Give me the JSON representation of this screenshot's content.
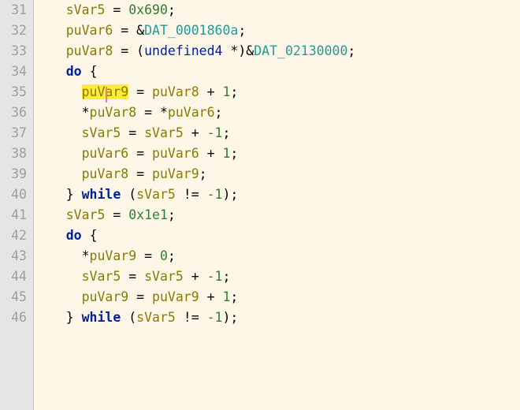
{
  "lines": [
    {
      "num": "31",
      "indent": "    ",
      "tokens": [
        {
          "t": "sVar5",
          "c": "tk-var"
        },
        {
          "t": " ",
          "c": ""
        },
        {
          "t": "=",
          "c": "tk-op"
        },
        {
          "t": " ",
          "c": ""
        },
        {
          "t": "0x690",
          "c": "tk-num"
        },
        {
          "t": ";",
          "c": "tk-punc"
        }
      ]
    },
    {
      "num": "32",
      "indent": "    ",
      "tokens": [
        {
          "t": "puVar6",
          "c": "tk-var"
        },
        {
          "t": " ",
          "c": ""
        },
        {
          "t": "=",
          "c": "tk-op"
        },
        {
          "t": " ",
          "c": ""
        },
        {
          "t": "&",
          "c": "tk-op"
        },
        {
          "t": "DAT_0001860a",
          "c": "tk-dat"
        },
        {
          "t": ";",
          "c": "tk-punc"
        }
      ]
    },
    {
      "num": "33",
      "indent": "    ",
      "tokens": [
        {
          "t": "puVar8",
          "c": "tk-var"
        },
        {
          "t": " ",
          "c": ""
        },
        {
          "t": "=",
          "c": "tk-op"
        },
        {
          "t": " ",
          "c": ""
        },
        {
          "t": "(",
          "c": "tk-punc"
        },
        {
          "t": "undefined4",
          "c": "tk-type"
        },
        {
          "t": " ",
          "c": ""
        },
        {
          "t": "*",
          "c": "tk-op"
        },
        {
          "t": ")",
          "c": "tk-punc"
        },
        {
          "t": "&",
          "c": "tk-op"
        },
        {
          "t": "DAT_02130000",
          "c": "tk-dat"
        },
        {
          "t": ";",
          "c": "tk-punc"
        }
      ]
    },
    {
      "num": "34",
      "indent": "    ",
      "tokens": [
        {
          "t": "do",
          "c": "tk-keyword"
        },
        {
          "t": " ",
          "c": ""
        },
        {
          "t": "{",
          "c": "tk-punc"
        }
      ]
    },
    {
      "num": "35",
      "indent": "      ",
      "highlight": true,
      "highlightText": "puVar9",
      "cursorPos": 3,
      "tokens": [
        {
          "t": "puVar9",
          "c": "tk-var highlight"
        },
        {
          "t": " ",
          "c": ""
        },
        {
          "t": "=",
          "c": "tk-op"
        },
        {
          "t": " ",
          "c": ""
        },
        {
          "t": "puVar8",
          "c": "tk-var"
        },
        {
          "t": " ",
          "c": ""
        },
        {
          "t": "+",
          "c": "tk-op"
        },
        {
          "t": " ",
          "c": ""
        },
        {
          "t": "1",
          "c": "tk-num"
        },
        {
          "t": ";",
          "c": "tk-punc"
        }
      ]
    },
    {
      "num": "36",
      "indent": "      ",
      "tokens": [
        {
          "t": "*",
          "c": "tk-deref"
        },
        {
          "t": "puVar8",
          "c": "tk-var"
        },
        {
          "t": " ",
          "c": ""
        },
        {
          "t": "=",
          "c": "tk-op"
        },
        {
          "t": " ",
          "c": ""
        },
        {
          "t": "*",
          "c": "tk-deref"
        },
        {
          "t": "puVar6",
          "c": "tk-var"
        },
        {
          "t": ";",
          "c": "tk-punc"
        }
      ]
    },
    {
      "num": "37",
      "indent": "      ",
      "tokens": [
        {
          "t": "sVar5",
          "c": "tk-var"
        },
        {
          "t": " ",
          "c": ""
        },
        {
          "t": "=",
          "c": "tk-op"
        },
        {
          "t": " ",
          "c": ""
        },
        {
          "t": "sVar5",
          "c": "tk-var"
        },
        {
          "t": " ",
          "c": ""
        },
        {
          "t": "+",
          "c": "tk-op"
        },
        {
          "t": " ",
          "c": ""
        },
        {
          "t": "-1",
          "c": "tk-num"
        },
        {
          "t": ";",
          "c": "tk-punc"
        }
      ]
    },
    {
      "num": "38",
      "indent": "      ",
      "tokens": [
        {
          "t": "puVar6",
          "c": "tk-var"
        },
        {
          "t": " ",
          "c": ""
        },
        {
          "t": "=",
          "c": "tk-op"
        },
        {
          "t": " ",
          "c": ""
        },
        {
          "t": "puVar6",
          "c": "tk-var"
        },
        {
          "t": " ",
          "c": ""
        },
        {
          "t": "+",
          "c": "tk-op"
        },
        {
          "t": " ",
          "c": ""
        },
        {
          "t": "1",
          "c": "tk-num"
        },
        {
          "t": ";",
          "c": "tk-punc"
        }
      ]
    },
    {
      "num": "39",
      "indent": "      ",
      "tokens": [
        {
          "t": "puVar8",
          "c": "tk-var"
        },
        {
          "t": " ",
          "c": ""
        },
        {
          "t": "=",
          "c": "tk-op"
        },
        {
          "t": " ",
          "c": ""
        },
        {
          "t": "puVar9",
          "c": "tk-var"
        },
        {
          "t": ";",
          "c": "tk-punc"
        }
      ]
    },
    {
      "num": "40",
      "indent": "    ",
      "tokens": [
        {
          "t": "}",
          "c": "tk-punc"
        },
        {
          "t": " ",
          "c": ""
        },
        {
          "t": "while",
          "c": "tk-keyword"
        },
        {
          "t": " ",
          "c": ""
        },
        {
          "t": "(",
          "c": "tk-punc"
        },
        {
          "t": "sVar5",
          "c": "tk-var"
        },
        {
          "t": " ",
          "c": ""
        },
        {
          "t": "!=",
          "c": "tk-op"
        },
        {
          "t": " ",
          "c": ""
        },
        {
          "t": "-1",
          "c": "tk-num"
        },
        {
          "t": ")",
          "c": "tk-punc"
        },
        {
          "t": ";",
          "c": "tk-punc"
        }
      ]
    },
    {
      "num": "41",
      "indent": "    ",
      "tokens": [
        {
          "t": "sVar5",
          "c": "tk-var"
        },
        {
          "t": " ",
          "c": ""
        },
        {
          "t": "=",
          "c": "tk-op"
        },
        {
          "t": " ",
          "c": ""
        },
        {
          "t": "0x1e1",
          "c": "tk-num"
        },
        {
          "t": ";",
          "c": "tk-punc"
        }
      ]
    },
    {
      "num": "42",
      "indent": "    ",
      "tokens": [
        {
          "t": "do",
          "c": "tk-keyword"
        },
        {
          "t": " ",
          "c": ""
        },
        {
          "t": "{",
          "c": "tk-punc"
        }
      ]
    },
    {
      "num": "43",
      "indent": "      ",
      "tokens": [
        {
          "t": "*",
          "c": "tk-deref"
        },
        {
          "t": "puVar9",
          "c": "tk-var"
        },
        {
          "t": " ",
          "c": ""
        },
        {
          "t": "=",
          "c": "tk-op"
        },
        {
          "t": " ",
          "c": ""
        },
        {
          "t": "0",
          "c": "tk-num"
        },
        {
          "t": ";",
          "c": "tk-punc"
        }
      ]
    },
    {
      "num": "44",
      "indent": "      ",
      "tokens": [
        {
          "t": "sVar5",
          "c": "tk-var"
        },
        {
          "t": " ",
          "c": ""
        },
        {
          "t": "=",
          "c": "tk-op"
        },
        {
          "t": " ",
          "c": ""
        },
        {
          "t": "sVar5",
          "c": "tk-var"
        },
        {
          "t": " ",
          "c": ""
        },
        {
          "t": "+",
          "c": "tk-op"
        },
        {
          "t": " ",
          "c": ""
        },
        {
          "t": "-1",
          "c": "tk-num"
        },
        {
          "t": ";",
          "c": "tk-punc"
        }
      ]
    },
    {
      "num": "45",
      "indent": "      ",
      "tokens": [
        {
          "t": "puVar9",
          "c": "tk-var"
        },
        {
          "t": " ",
          "c": ""
        },
        {
          "t": "=",
          "c": "tk-op"
        },
        {
          "t": " ",
          "c": ""
        },
        {
          "t": "puVar9",
          "c": "tk-var"
        },
        {
          "t": " ",
          "c": ""
        },
        {
          "t": "+",
          "c": "tk-op"
        },
        {
          "t": " ",
          "c": ""
        },
        {
          "t": "1",
          "c": "tk-num"
        },
        {
          "t": ";",
          "c": "tk-punc"
        }
      ]
    },
    {
      "num": "46",
      "indent": "    ",
      "tokens": [
        {
          "t": "}",
          "c": "tk-punc"
        },
        {
          "t": " ",
          "c": ""
        },
        {
          "t": "while",
          "c": "tk-keyword"
        },
        {
          "t": " ",
          "c": ""
        },
        {
          "t": "(",
          "c": "tk-punc"
        },
        {
          "t": "sVar5",
          "c": "tk-var"
        },
        {
          "t": " ",
          "c": ""
        },
        {
          "t": "!=",
          "c": "tk-op"
        },
        {
          "t": " ",
          "c": ""
        },
        {
          "t": "-1",
          "c": "tk-num"
        },
        {
          "t": ")",
          "c": "tk-punc"
        },
        {
          "t": ";",
          "c": "tk-punc"
        }
      ]
    }
  ]
}
